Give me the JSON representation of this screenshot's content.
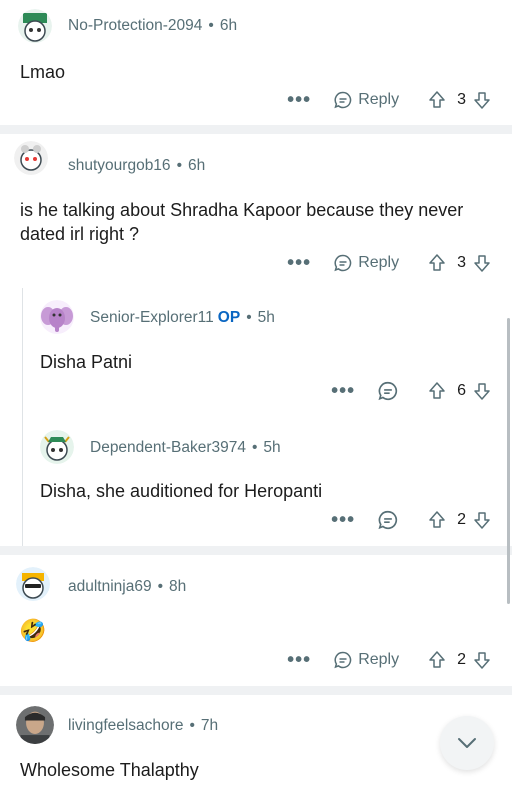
{
  "comments": [
    {
      "user": "No-Protection-2094",
      "time": "6h",
      "text": "Lmao",
      "reply_label": "Reply",
      "votes": "3"
    },
    {
      "user": "shutyourgob16",
      "time": "6h",
      "text": "is he talking about Shradha Kapoor because they never dated irl right ?",
      "reply_label": "Reply",
      "votes": "3"
    },
    {
      "user": "Senior-Explorer11",
      "op": "OP",
      "time": "5h",
      "text": "Disha Patni",
      "votes": "6"
    },
    {
      "user": "Dependent-Baker3974",
      "time": "5h",
      "text": "Disha, she auditioned for Heropanti",
      "votes": "2"
    },
    {
      "user": "adultninja69",
      "time": "8h",
      "text": "🤣",
      "reply_label": "Reply",
      "votes": "2"
    },
    {
      "user": "livingfeelsachore",
      "time": "7h",
      "text": "Wholesome Thalapthy"
    }
  ],
  "more_label": "•••",
  "sep_dot": "•",
  "colors": {
    "accent": "#0a66c2",
    "meta": "#576f76",
    "separator": "#eff1f3"
  }
}
